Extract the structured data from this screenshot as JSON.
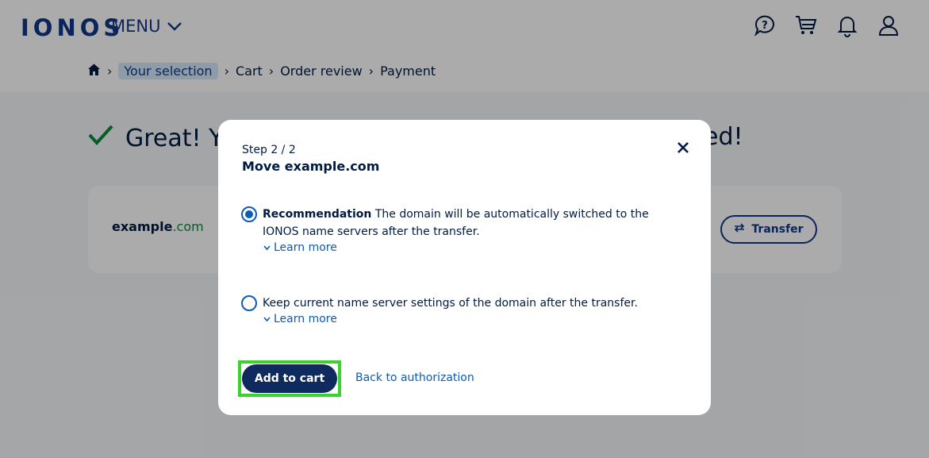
{
  "header": {
    "logo": "IONOS",
    "menu_label": "MENU",
    "icons": [
      "help-icon",
      "cart-icon",
      "bell-icon",
      "user-icon"
    ]
  },
  "breadcrumb": {
    "items": [
      "Your selection",
      "Cart",
      "Order review",
      "Payment"
    ],
    "active_index": 0
  },
  "page": {
    "success_prefix": "Great! Y",
    "success_suffix": "ed!",
    "domain_name": "example",
    "domain_tld": ".com",
    "transfer_label": "Transfer"
  },
  "modal": {
    "step": "Step 2 / 2",
    "title": "Move example.com",
    "option1": {
      "bold": "Recommendation",
      "text": " The domain will be automatically switched to the IONOS name servers after the transfer.",
      "checked": true
    },
    "option2": {
      "text": "Keep current name server settings of the domain after the transfer.",
      "checked": false
    },
    "learn_more": "Learn more",
    "add_to_cart": "Add to cart",
    "back_link": "Back to authorization"
  },
  "colors": {
    "brand": "#11388a",
    "primary_button": "#0f2a5f",
    "link": "#0b5cb4",
    "success": "#0b8a3a",
    "focus_ring": "#3bd12f"
  }
}
